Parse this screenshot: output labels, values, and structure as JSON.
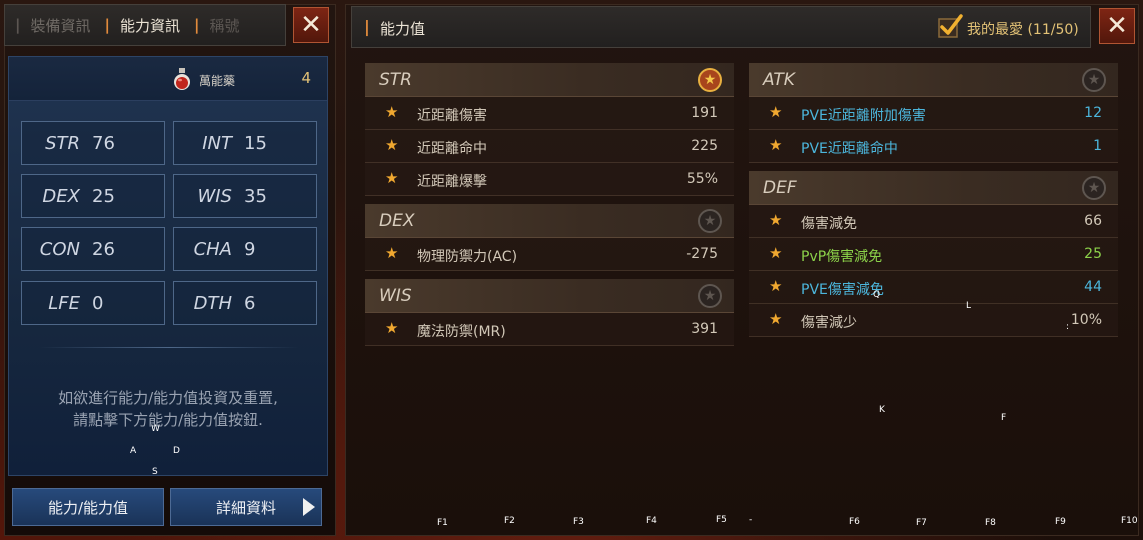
{
  "left": {
    "tabs": [
      {
        "label": "裝備資訊"
      },
      {
        "label": "能力資訊"
      },
      {
        "label": "稱號"
      }
    ],
    "close_icon": "close-icon",
    "potion": {
      "label": "萬能藥",
      "count": "4"
    },
    "stats": [
      {
        "name": "STR",
        "value": "76"
      },
      {
        "name": "INT",
        "value": "15"
      },
      {
        "name": "DEX",
        "value": "25"
      },
      {
        "name": "WIS",
        "value": "35"
      },
      {
        "name": "CON",
        "value": "26"
      },
      {
        "name": "CHA",
        "value": "9"
      },
      {
        "name": "LFE",
        "value": "0"
      },
      {
        "name": "DTH",
        "value": "6"
      }
    ],
    "info_line1": "如欲進行能力/能力值投資及重置,",
    "info_line2": "請點擊下方能力/能力值按鈕.",
    "buttons": {
      "ability": "能力/能力值",
      "detail": "詳細資料"
    }
  },
  "right": {
    "title": "能力值",
    "favorites_label": "我的最愛 (11/50)",
    "sections": {
      "str": {
        "title": "STR",
        "rows": [
          {
            "label": "近距離傷害",
            "value": "191"
          },
          {
            "label": "近距離命中",
            "value": "225"
          },
          {
            "label": "近距離爆擊",
            "value": "55%"
          }
        ]
      },
      "dex": {
        "title": "DEX",
        "rows": [
          {
            "label": "物理防禦力(AC)",
            "value": "-275"
          }
        ]
      },
      "wis": {
        "title": "WIS",
        "rows": [
          {
            "label": "魔法防禦(MR)",
            "value": "391"
          }
        ]
      },
      "atk": {
        "title": "ATK",
        "rows": [
          {
            "label": "PVE近距離附加傷害",
            "value": "12"
          },
          {
            "label": "PVE近距離命中",
            "value": "1"
          }
        ]
      },
      "def": {
        "title": "DEF",
        "rows": [
          {
            "label": "傷害減免",
            "value": "66"
          },
          {
            "label": "PvP傷害減免",
            "value": "25"
          },
          {
            "label": "PVE傷害減免",
            "value": "44"
          },
          {
            "label": "傷害減少",
            "value": "10%"
          }
        ]
      }
    }
  },
  "key_hints": {
    "w": "W",
    "a": "A",
    "s": "S",
    "d": "D",
    "q": "Q",
    "l": "L",
    "k": "K",
    "f": "F",
    "colon": ":",
    "f1": "F1",
    "f2": "F2",
    "f3": "F3",
    "f4": "F4",
    "f5": "F5",
    "dash": "-",
    "f6": "F6",
    "f7": "F7",
    "f8": "F8",
    "f9": "F9",
    "f10": "F10"
  },
  "colors": {
    "accent": "#e08a3c",
    "gold": "#e3c276",
    "blue_value": "#4cb6dc",
    "green_value": "#8cd24a"
  }
}
